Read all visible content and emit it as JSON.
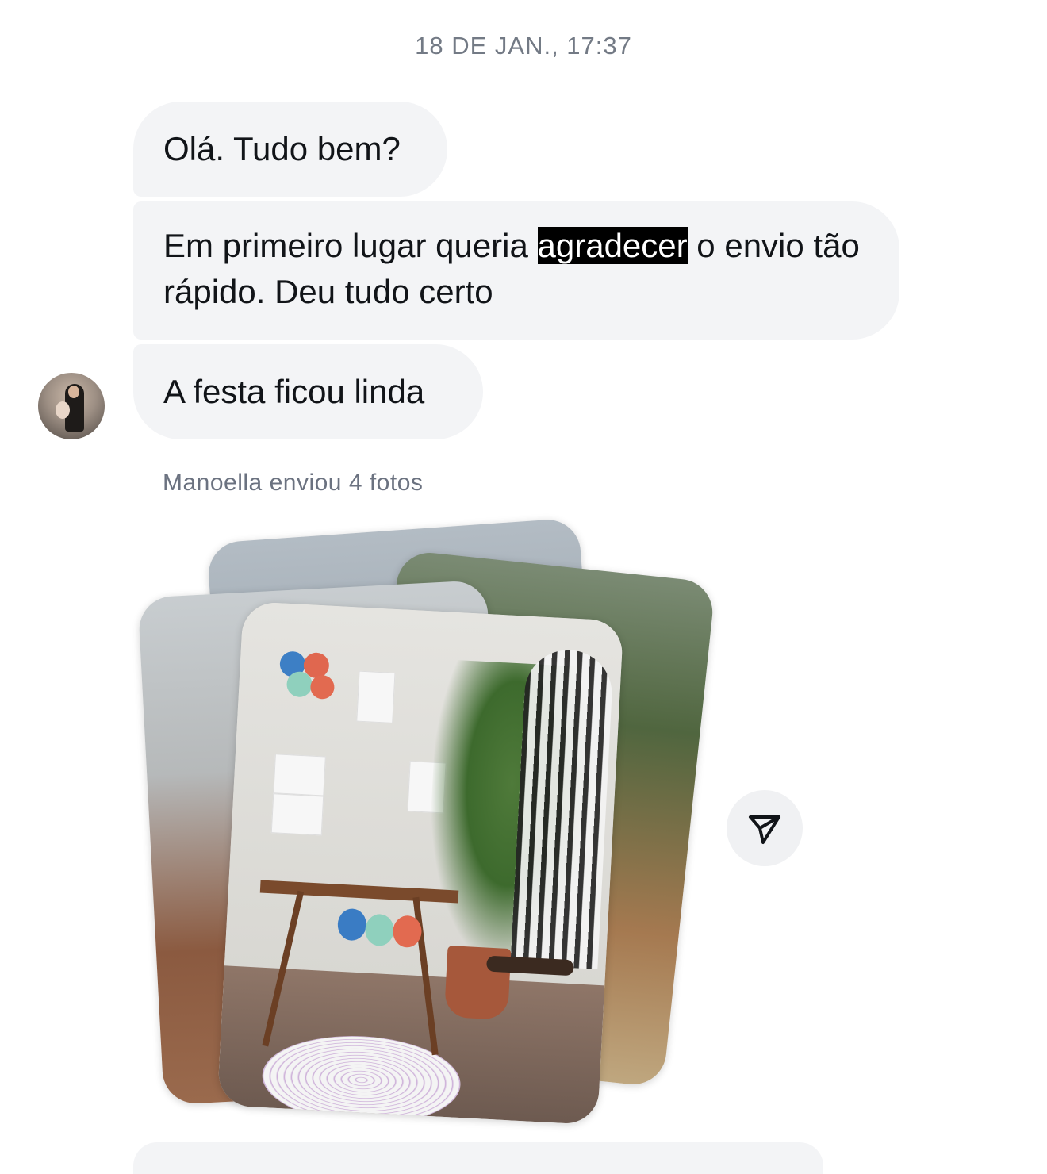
{
  "header": {
    "timestamp": "18 DE JAN., 17:37"
  },
  "messages": [
    {
      "text": "Olá. Tudo bem?"
    },
    {
      "text_before": "Em primeiro lugar queria ",
      "highlight": "agradecer",
      "text_after": " o envio tão rápido. Deu tudo certo"
    },
    {
      "text": "A festa ficou linda"
    }
  ],
  "sender": {
    "avatar_icon": "user-avatar"
  },
  "photos": {
    "note": "Manoella enviou 4 fotos",
    "count": 4
  },
  "actions": {
    "share_icon": "send-arrow-icon"
  },
  "colors": {
    "bubble_bg": "#f3f4f6",
    "highlight_bg": "#000000",
    "muted_text": "#737a85"
  }
}
